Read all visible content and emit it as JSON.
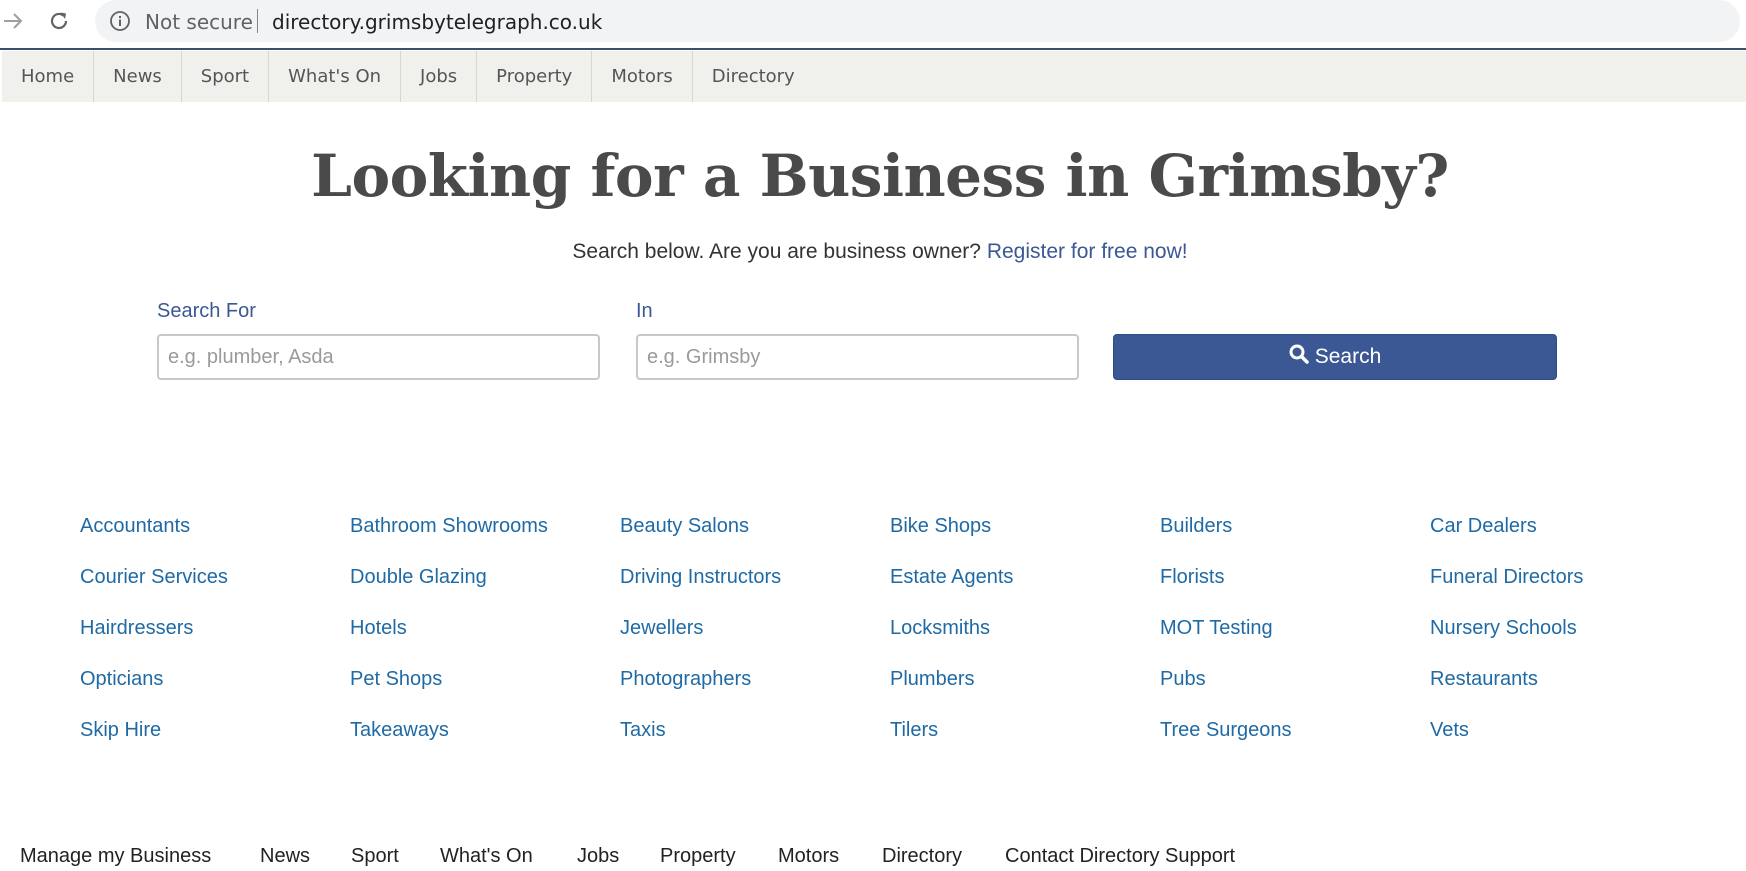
{
  "browser": {
    "security_text": "Not secure",
    "url": "directory.grimsbytelegraph.co.uk"
  },
  "topnav": [
    "Home",
    "News",
    "Sport",
    "What's On",
    "Jobs",
    "Property",
    "Motors",
    "Directory"
  ],
  "hero": {
    "title": "Looking for a Business in Grimsby?",
    "subtitle": "Search below. Are you are business owner?",
    "register_link": "Register for free now!"
  },
  "search": {
    "what_label": "Search For",
    "what_placeholder": "e.g. plumber, Asda",
    "where_label": "In",
    "where_placeholder": "e.g. Grimsby",
    "button_label": "Search"
  },
  "categories": [
    [
      "Accountants",
      "Bathroom Showrooms",
      "Beauty Salons",
      "Bike Shops",
      "Builders",
      "Car Dealers"
    ],
    [
      "Courier Services",
      "Double Glazing",
      "Driving Instructors",
      "Estate Agents",
      "Florists",
      "Funeral Directors"
    ],
    [
      "Hairdressers",
      "Hotels",
      "Jewellers",
      "Locksmiths",
      "MOT Testing",
      "Nursery Schools"
    ],
    [
      "Opticians",
      "Pet Shops",
      "Photographers",
      "Plumbers",
      "Pubs",
      "Restaurants"
    ],
    [
      "Skip Hire",
      "Takeaways",
      "Taxis",
      "Tilers",
      "Tree Surgeons",
      "Vets"
    ]
  ],
  "footer": [
    "Manage my Business",
    "News",
    "Sport",
    "What's On",
    "Jobs",
    "Property",
    "Motors",
    "Directory",
    "Contact Directory Support"
  ],
  "colors": {
    "brand_blue": "#3b5894",
    "link_blue": "#1f6aa5",
    "nav_bg": "#f0f0ec"
  }
}
